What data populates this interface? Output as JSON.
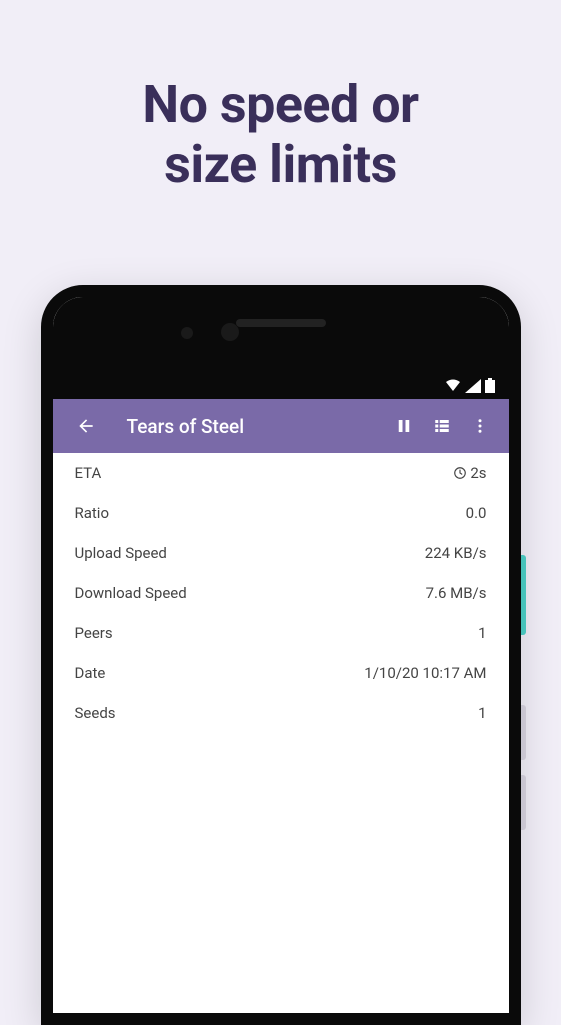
{
  "headline_line1": "No speed or",
  "headline_line2": "size limits",
  "toolbar": {
    "title": "Tears of Steel"
  },
  "details": {
    "eta": {
      "label": "ETA",
      "value": "2s"
    },
    "ratio": {
      "label": "Ratio",
      "value": "0.0"
    },
    "upload_speed": {
      "label": "Upload Speed",
      "value": "224 KB/s"
    },
    "download_speed": {
      "label": "Download Speed",
      "value": "7.6 MB/s"
    },
    "peers": {
      "label": "Peers",
      "value": "1"
    },
    "date": {
      "label": "Date",
      "value": "1/10/20 10:17 AM"
    },
    "seeds": {
      "label": "Seeds",
      "value": "1"
    }
  },
  "colors": {
    "background": "#f1eef7",
    "headline": "#3a2f5a",
    "toolbar": "#7a6aa8"
  }
}
